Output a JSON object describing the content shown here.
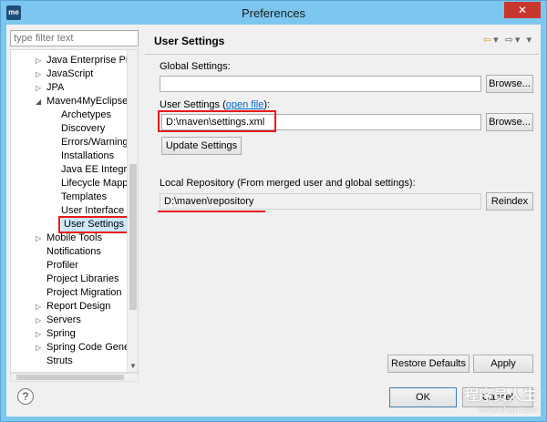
{
  "window": {
    "title": "Preferences",
    "app_icon": "me",
    "close_glyph": "✕"
  },
  "filter": {
    "placeholder": "type filter text"
  },
  "tree": {
    "items": [
      {
        "label": "Java Enterprise Pr",
        "expandable": true
      },
      {
        "label": "JavaScript",
        "expandable": true
      },
      {
        "label": "JPA",
        "expandable": true
      },
      {
        "label": "Maven4MyEclipse",
        "expanded": true
      },
      {
        "label": "Archetypes"
      },
      {
        "label": "Discovery"
      },
      {
        "label": "Errors/Warning"
      },
      {
        "label": "Installations"
      },
      {
        "label": "Java EE Integra"
      },
      {
        "label": "Lifecycle Mapp"
      },
      {
        "label": "Templates"
      },
      {
        "label": "User Interface"
      },
      {
        "label": "User Settings",
        "selected": true
      },
      {
        "label": "Mobile Tools",
        "expandable": true
      },
      {
        "label": "Notifications"
      },
      {
        "label": "Profiler"
      },
      {
        "label": "Project Libraries"
      },
      {
        "label": "Project Migration"
      },
      {
        "label": "Report Design",
        "expandable": true
      },
      {
        "label": "Servers",
        "expandable": true
      },
      {
        "label": "Spring",
        "expandable": true
      },
      {
        "label": "Spring Code Gene",
        "expandable": true
      },
      {
        "label": "Struts"
      }
    ]
  },
  "panel": {
    "title": "User Settings",
    "global_settings_label": "Global Settings:",
    "global_settings_value": "",
    "user_settings_label_prefix": "User Settings (",
    "open_file_link": "open file",
    "user_settings_label_suffix": "):",
    "user_settings_value": "D:\\maven\\settings.xml",
    "browse_label": "Browse...",
    "update_settings_label": "Update Settings",
    "local_repo_label": "Local Repository (From merged user and global settings):",
    "local_repo_value": "D:\\maven\\repository",
    "reindex_label": "Reindex",
    "restore_defaults_label": "Restore Defaults",
    "apply_label": "Apply"
  },
  "footer": {
    "help_glyph": "?",
    "ok_label": "OK",
    "cancel_label": "Cancel"
  },
  "watermark": {
    "line1": "程序员人生",
    "line2": "www.wfuyu.com"
  }
}
